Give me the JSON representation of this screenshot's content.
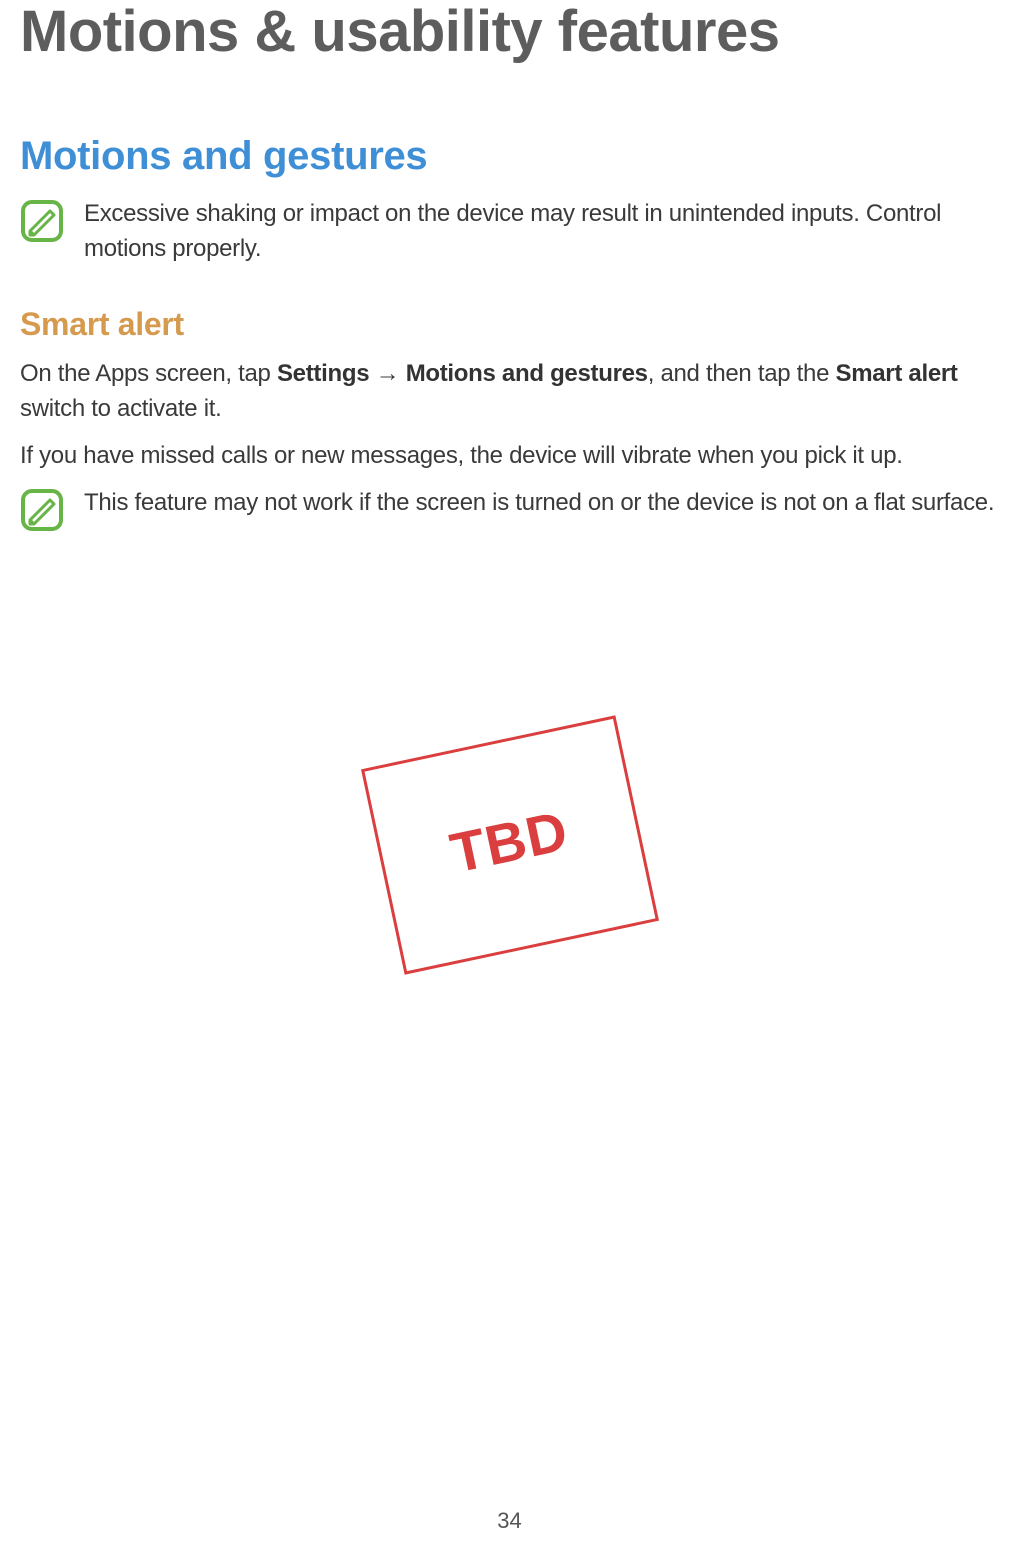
{
  "title": "Motions & usability features",
  "section": "Motions and gestures",
  "note1": "Excessive shaking or impact on the device may result in unintended inputs. Control motions properly.",
  "subsection": "Smart alert",
  "instruction": {
    "prefix": "On the Apps screen, tap ",
    "bold1": "Settings",
    "arrow": " → ",
    "bold2": "Motions and gestures",
    "mid": ", and then tap the ",
    "bold3": "Smart alert",
    "suffix": " switch to activate it."
  },
  "body2": "If you have missed calls or new messages, the device will vibrate when you pick it up.",
  "note2": "This feature may not work if the screen is turned on or the device is not on a flat surface.",
  "placeholder": "TBD",
  "page_number": "34"
}
